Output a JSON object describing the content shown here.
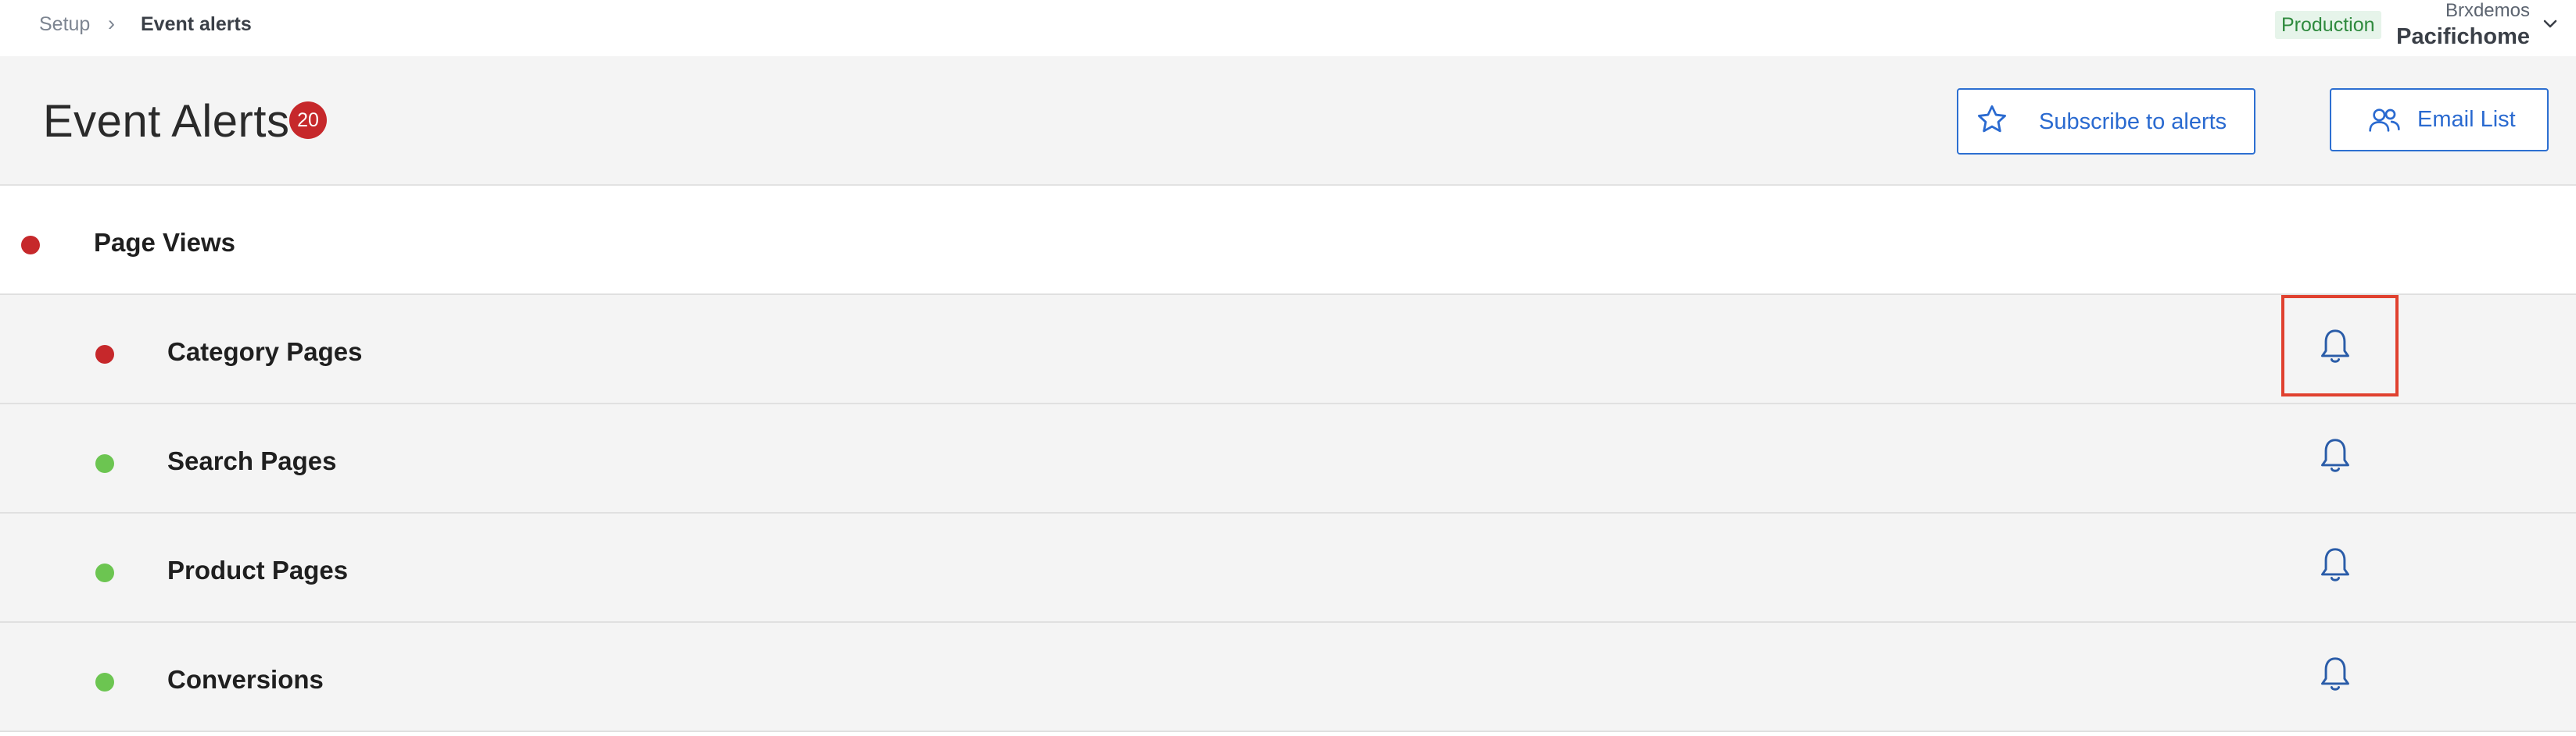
{
  "breadcrumb": {
    "root": "Setup",
    "separator": "›",
    "current": "Event alerts"
  },
  "environment": {
    "label": "Production",
    "bg": "#e6f4ea",
    "color": "#2f8a3e"
  },
  "account": {
    "org": "Brxdemos",
    "name": "Pacifichome",
    "icon": "chevron-down-icon"
  },
  "header": {
    "title": "Event Alerts",
    "count": "20",
    "subscribe_label": "Subscribe to alerts",
    "subscribe_icon": "star-icon",
    "email_label": "Email List",
    "email_icon": "users-icon"
  },
  "colors": {
    "accent": "#2a6ad0",
    "alert_red": "#c6282b",
    "ok_green": "#6cc551",
    "highlight": "#e0412f"
  },
  "alerts": [
    {
      "label": "Page Views",
      "status": "error",
      "level": "parent"
    },
    {
      "label": "Category Pages",
      "status": "error",
      "level": "child",
      "bell": "bell-icon",
      "highlighted": true
    },
    {
      "label": "Search Pages",
      "status": "ok",
      "level": "child",
      "bell": "bell-icon"
    },
    {
      "label": "Product Pages",
      "status": "ok",
      "level": "child",
      "bell": "bell-icon"
    },
    {
      "label": "Conversions",
      "status": "ok",
      "level": "child",
      "bell": "bell-icon"
    }
  ]
}
